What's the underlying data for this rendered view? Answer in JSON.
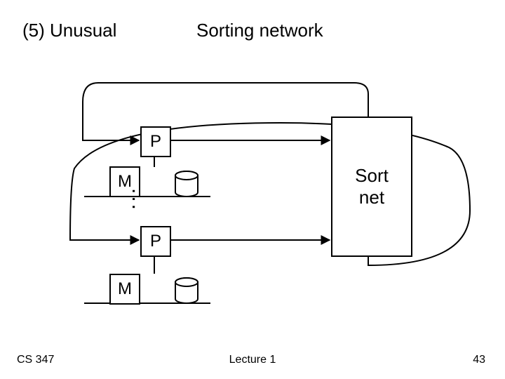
{
  "title": {
    "left": "(5) Unusual",
    "right": "Sorting network"
  },
  "nodes": {
    "p_label": "P",
    "m_label": "M",
    "sortnet_line1": "Sort",
    "sortnet_line2": "net",
    "ellipsis": "..."
  },
  "footer": {
    "course": "CS 347",
    "lecture": "Lecture 1",
    "page": "43"
  }
}
